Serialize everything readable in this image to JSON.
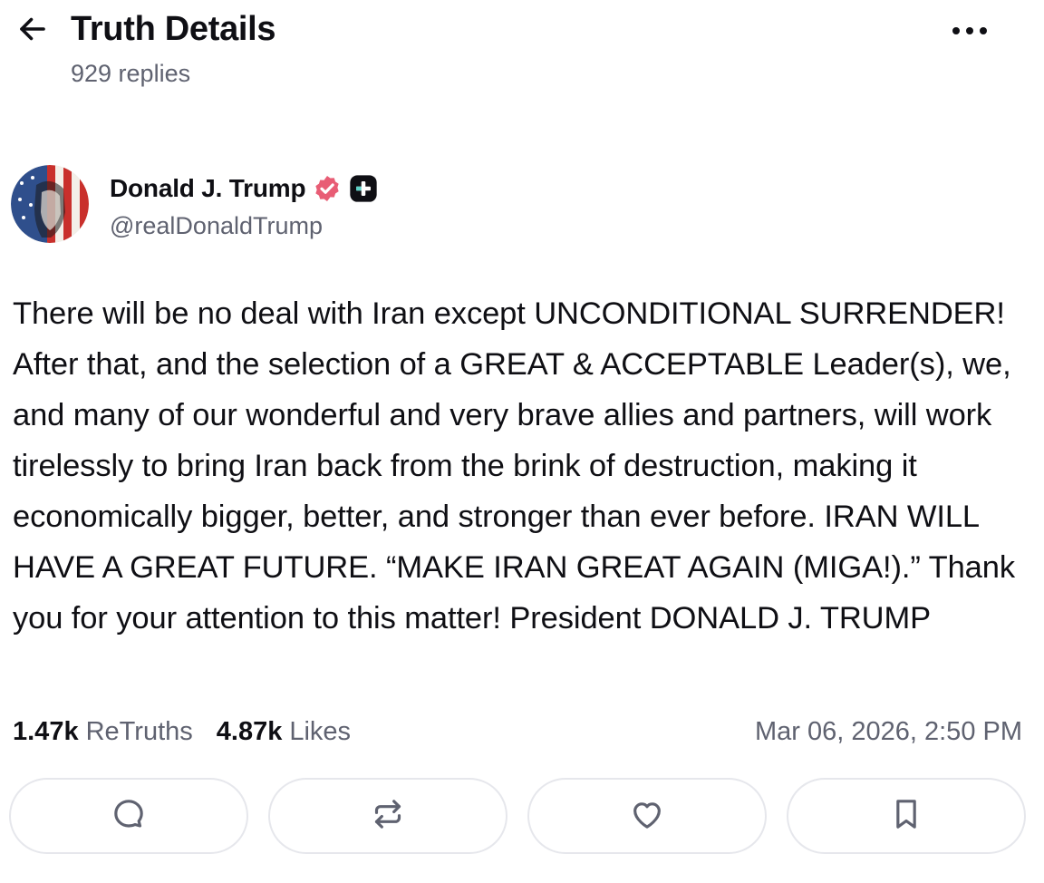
{
  "header": {
    "title": "Truth Details",
    "reply_count": "929 replies",
    "back_icon": "arrow-left-icon",
    "more_icon": "more-horizontal-icon"
  },
  "author": {
    "name": "Donald J. Trump",
    "handle": "@realDonaldTrump",
    "verified_icon": "verified-badge-icon",
    "verified_color": "#e85d75",
    "plus_badge_icon": "plus-badge-icon"
  },
  "post": {
    "text": "There will be no deal with Iran except UNCONDITIONAL SURRENDER! After that, and the selection of a GREAT & ACCEPTABLE Leader(s), we, and many of our wonderful and very brave allies and partners, will work tirelessly to bring Iran back from the brink of destruction, making it economically bigger, better, and stronger than ever before. IRAN WILL HAVE A GREAT FUTURE. “MAKE IRAN GREAT AGAIN (MIGA!).” Thank you for your attention to this matter! President DONALD J. TRUMP"
  },
  "stats": {
    "retruths_value": "1.47k",
    "retruths_label": "ReTruths",
    "likes_value": "4.87k",
    "likes_label": "Likes",
    "timestamp": "Mar 06, 2026, 2:50 PM"
  },
  "actions": [
    {
      "icon": "reply-icon"
    },
    {
      "icon": "retruth-icon"
    },
    {
      "icon": "like-heart-icon"
    },
    {
      "icon": "bookmark-icon"
    }
  ],
  "colors": {
    "text_primary": "#0f0f14",
    "text_secondary": "#5f6270",
    "border": "#e6e7ec",
    "icon": "#5f6270"
  }
}
